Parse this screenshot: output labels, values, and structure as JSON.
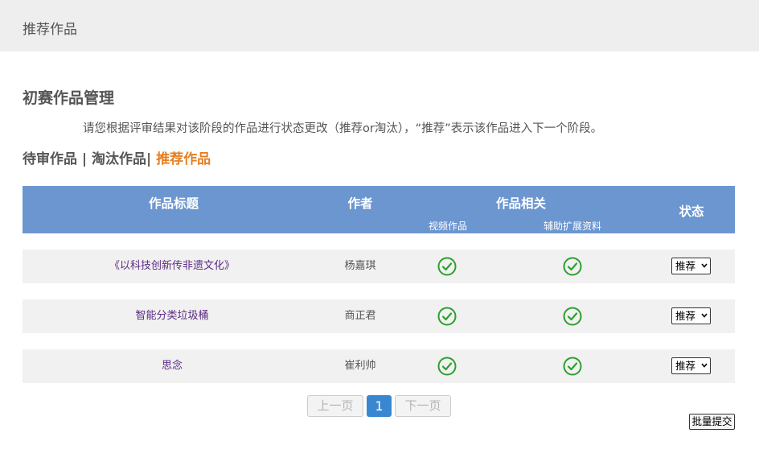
{
  "topbar": {
    "title": "推荐作品"
  },
  "page": {
    "section_title": "初赛作品管理",
    "instructions": "请您根据评审结果对该阶段的作品进行状态更改（推荐or淘汰），“推荐”表示该作品进入下一个阶段。"
  },
  "filters": {
    "pending": "待审作品",
    "sep1": " | ",
    "rejected": "淘汰作品",
    "sep2": "| ",
    "recommended": "推荐作品",
    "active_color": "#e67e22"
  },
  "table": {
    "header_color": "#6c96d0",
    "headers": {
      "title": "作品标题",
      "author": "作者",
      "related": "作品相关",
      "video": "视频作品",
      "extra": "辅助扩展资料",
      "status": "状态"
    },
    "check_icon": "check-circle-icon",
    "check_color": "#2ca02c",
    "rows": [
      {
        "title": "《以科技创新传非遗文化》",
        "author": "杨嘉琪",
        "video": true,
        "extra": true,
        "status": "推荐"
      },
      {
        "title": "智能分类垃圾桶",
        "author": "商正君",
        "video": true,
        "extra": true,
        "status": "推荐"
      },
      {
        "title": "思念",
        "author": "崔利帅",
        "video": true,
        "extra": true,
        "status": "推荐"
      }
    ]
  },
  "pagination": {
    "prev": "上一页",
    "current": "1",
    "next": "下一页"
  },
  "actions": {
    "batch_submit": "批量提交"
  }
}
